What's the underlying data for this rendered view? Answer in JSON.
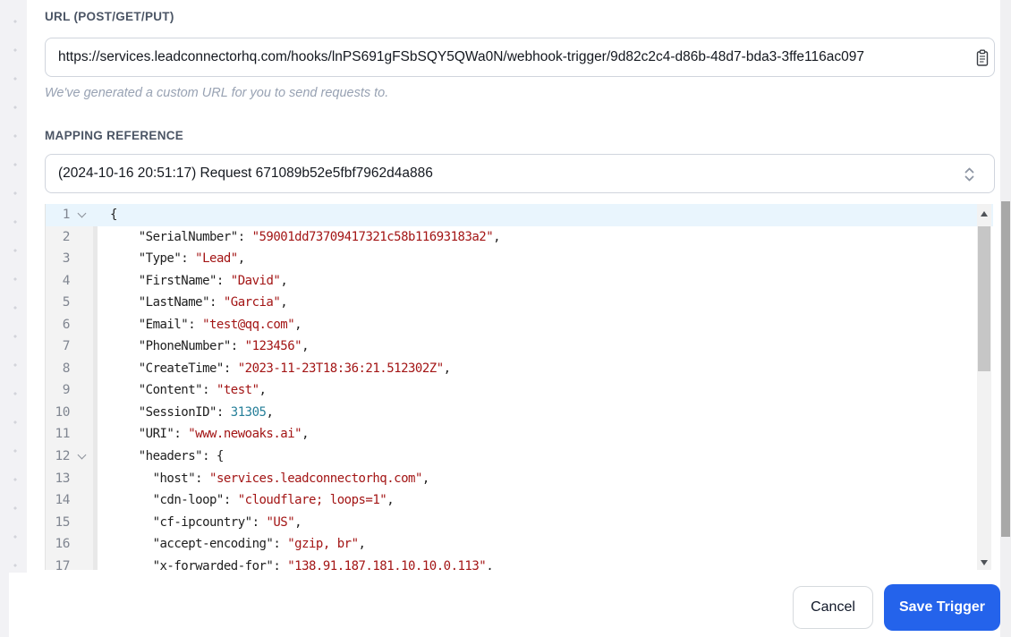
{
  "url_section": {
    "label": "URL (POST/GET/PUT)",
    "value": "https://services.leadconnectorhq.com/hooks/lnPS691gFSbSQY5QWa0N/webhook-trigger/9d82c2c4-d86b-48d7-bda3-3ffe116ac097",
    "helper": "We've generated a custom URL for you to send requests to."
  },
  "mapping_section": {
    "label": "MAPPING REFERENCE",
    "selected_option": "(2024-10-16 20:51:17) Request 671089b52e5fbf7962d4a886"
  },
  "editor": {
    "lines": [
      {
        "num": "1",
        "fold": true,
        "active": true,
        "segments": [
          [
            "p",
            "{"
          ]
        ]
      },
      {
        "num": "2",
        "segments": [
          [
            "p",
            "    \"SerialNumber\": "
          ],
          [
            "s",
            "\"59001dd73709417321c58b11693183a2\""
          ],
          [
            "p",
            ","
          ]
        ]
      },
      {
        "num": "3",
        "segments": [
          [
            "p",
            "    \"Type\": "
          ],
          [
            "s",
            "\"Lead\""
          ],
          [
            "p",
            ","
          ]
        ]
      },
      {
        "num": "4",
        "segments": [
          [
            "p",
            "    \"FirstName\": "
          ],
          [
            "s",
            "\"David\""
          ],
          [
            "p",
            ","
          ]
        ]
      },
      {
        "num": "5",
        "segments": [
          [
            "p",
            "    \"LastName\": "
          ],
          [
            "s",
            "\"Garcia\""
          ],
          [
            "p",
            ","
          ]
        ]
      },
      {
        "num": "6",
        "segments": [
          [
            "p",
            "    \"Email\": "
          ],
          [
            "s",
            "\"test@qq.com\""
          ],
          [
            "p",
            ","
          ]
        ]
      },
      {
        "num": "7",
        "segments": [
          [
            "p",
            "    \"PhoneNumber\": "
          ],
          [
            "s",
            "\"123456\""
          ],
          [
            "p",
            ","
          ]
        ]
      },
      {
        "num": "8",
        "segments": [
          [
            "p",
            "    \"CreateTime\": "
          ],
          [
            "s",
            "\"2023-11-23T18:36:21.512302Z\""
          ],
          [
            "p",
            ","
          ]
        ]
      },
      {
        "num": "9",
        "segments": [
          [
            "p",
            "    \"Content\": "
          ],
          [
            "s",
            "\"test\""
          ],
          [
            "p",
            ","
          ]
        ]
      },
      {
        "num": "10",
        "segments": [
          [
            "p",
            "    \"SessionID\": "
          ],
          [
            "n",
            "31305"
          ],
          [
            "p",
            ","
          ]
        ]
      },
      {
        "num": "11",
        "segments": [
          [
            "p",
            "    \"URI\": "
          ],
          [
            "s",
            "\"www.newoaks.ai\""
          ],
          [
            "p",
            ","
          ]
        ]
      },
      {
        "num": "12",
        "fold": true,
        "segments": [
          [
            "p",
            "    \"headers\": {"
          ]
        ]
      },
      {
        "num": "13",
        "segments": [
          [
            "p",
            "      \"host\": "
          ],
          [
            "s",
            "\"services.leadconnectorhq.com\""
          ],
          [
            "p",
            ","
          ]
        ]
      },
      {
        "num": "14",
        "segments": [
          [
            "p",
            "      \"cdn-loop\": "
          ],
          [
            "s",
            "\"cloudflare; loops=1\""
          ],
          [
            "p",
            ","
          ]
        ]
      },
      {
        "num": "15",
        "segments": [
          [
            "p",
            "      \"cf-ipcountry\": "
          ],
          [
            "s",
            "\"US\""
          ],
          [
            "p",
            ","
          ]
        ]
      },
      {
        "num": "16",
        "segments": [
          [
            "p",
            "      \"accept-encoding\": "
          ],
          [
            "s",
            "\"gzip, br\""
          ],
          [
            "p",
            ","
          ]
        ]
      },
      {
        "num": "17",
        "segments": [
          [
            "p",
            "      \"x-forwarded-for\": "
          ],
          [
            "s",
            "\"138.91.187.181,10.10.0.113\""
          ],
          [
            "p",
            ","
          ]
        ]
      }
    ]
  },
  "footer": {
    "cancel_label": "Cancel",
    "save_label": "Save Trigger"
  },
  "icons": {
    "clipboard": "copy-url-to-clipboard",
    "unfold": "select-unfold-chevrons",
    "fold": "code-fold-chevron"
  },
  "colors": {
    "accent_blue": "#2463eb",
    "string_token": "#a31515",
    "number_token": "#267f99",
    "active_line_bg": "#e9f5fd"
  }
}
